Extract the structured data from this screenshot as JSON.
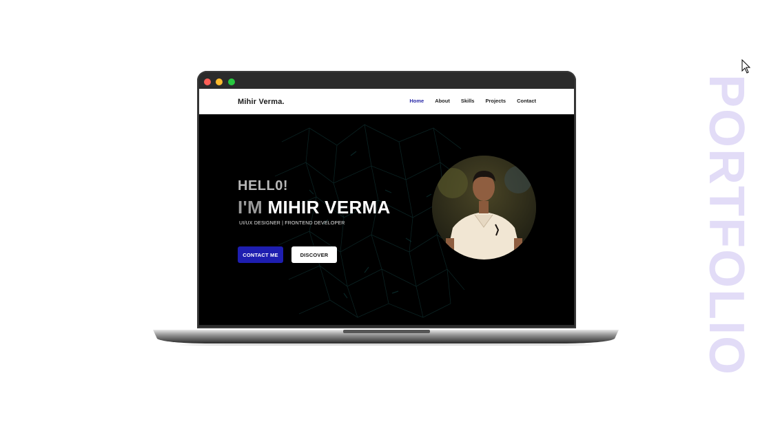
{
  "window": {
    "controls": [
      "close",
      "minimize",
      "maximize"
    ],
    "colors": {
      "close": "#ff5f57",
      "minimize": "#febc2e",
      "maximize": "#28c840"
    }
  },
  "site": {
    "brand": "Mihir Verma.",
    "nav": [
      {
        "label": "Home",
        "active": true
      },
      {
        "label": "About",
        "active": false
      },
      {
        "label": "Skills",
        "active": false
      },
      {
        "label": "Projects",
        "active": false
      },
      {
        "label": "Contact",
        "active": false
      }
    ],
    "hero": {
      "greeting": "HELL0!",
      "intro_prefix": "I'M",
      "name": "MIHIR VERMA",
      "role": "UI/UX DESIGNER | FRONTEND DEVELOPER",
      "buttons": {
        "contact_label": "CONTACT ME",
        "discover_label": "DISCOVER"
      },
      "profile_image_icon": "profile-photo"
    },
    "accent_color": "#1e1eb0"
  },
  "side_text": "PORTFOLIO",
  "side_text_color": "#e2dcf7"
}
